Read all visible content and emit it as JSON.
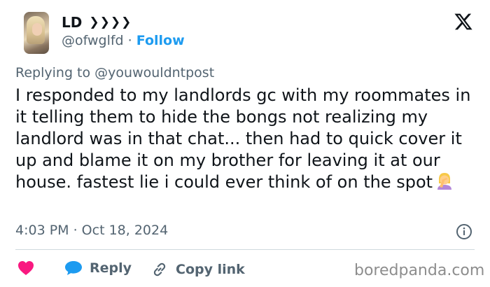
{
  "author": {
    "name": "LD",
    "name_suffix": "❯❯❯❯",
    "handle": "@ofwglfd",
    "separator": "·",
    "follow_label": "Follow"
  },
  "tweet": {
    "replying_prefix": "Replying to",
    "replying_to": "@youwouldntpost",
    "text": "I responded to my landlords gc with my roommates in it telling them to hide the bongs not realizing my landlord was in that chat... then had to quick cover it up and blame it on my brother for leaving it at our house. fastest lie i could ever think of on the spot",
    "emoji_icon": "woman-facepalming-icon",
    "timestamp": "4:03 PM · Oct 18, 2024"
  },
  "actions": {
    "like_icon": "heart-icon",
    "reply_label": "Reply",
    "copy_link_label": "Copy link"
  },
  "watermark": "boredpanda.com",
  "colors": {
    "accent": "#1d9bf0",
    "like": "#f91880",
    "secondary_text": "#536471"
  }
}
